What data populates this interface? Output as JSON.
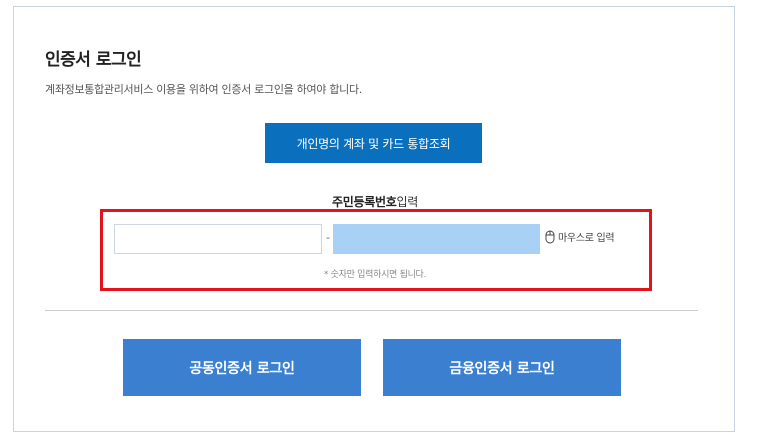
{
  "page": {
    "title": "인증서 로그인",
    "subtitle": "계좌정보통합관리서비스 이용을 위하여 인증서 로그인을 하여야 합니다."
  },
  "inquiry_button": {
    "label": "개인명의 계좌 및 카드 통합조회"
  },
  "rrn": {
    "label_bold": "주민등록번호",
    "label_rest": "입력",
    "separator": "-",
    "front_value": "",
    "back_value": "",
    "mouse_input_label": "마우스로 입력",
    "hint": "* 숫자만 입력하시면 됩니다."
  },
  "login": {
    "joint_cert_label": "공동인증서 로그인",
    "finance_cert_label": "금융인증서 로그인"
  },
  "colors": {
    "primary_blue": "#0a6fbc",
    "login_blue": "#3a7fd0",
    "masked_field": "#a9d0f5",
    "highlight_red": "#e2131a"
  },
  "icons": {
    "mouse": "mouse-icon"
  }
}
